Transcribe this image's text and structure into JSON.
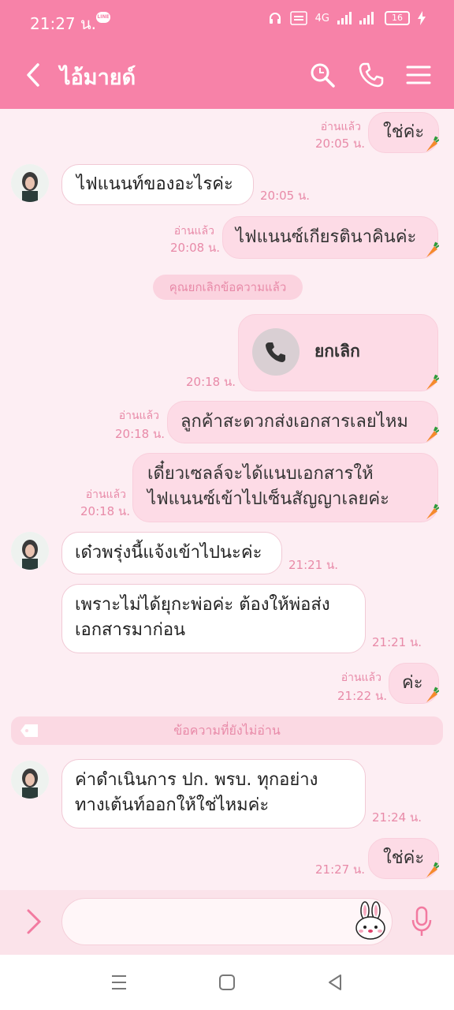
{
  "status": {
    "time": "21:27 น.",
    "line_badge": "LINE",
    "battery": "16",
    "network": "4G"
  },
  "header": {
    "title": "ไอ้มายด์"
  },
  "messages": [
    {
      "dir": "out",
      "text": "ใช่ค่ะ",
      "read": "อ่านแล้ว",
      "time": "20:05 น."
    },
    {
      "dir": "in",
      "text": "ไฟแนนท์ของอะไรค่ะ",
      "time": "20:05 น."
    },
    {
      "dir": "out",
      "text": "ไฟแนนซ์เกียรตินาคินค่ะ",
      "read": "อ่านแล้ว",
      "time": "20:08 น."
    },
    {
      "dir": "system",
      "text": "คุณยกเลิกข้อความแล้ว"
    },
    {
      "dir": "out",
      "type": "call",
      "text": "ยกเลิก",
      "time": "20:18 น."
    },
    {
      "dir": "out",
      "text": "ลูกค้าสะดวกส่งเอกสารเลยไหม",
      "read": "อ่านแล้ว",
      "time": "20:18 น."
    },
    {
      "dir": "out",
      "text_line1": "เดี๋ยวเซลล์จะได้แนบเอกสารให้",
      "text_line2": "ไฟแนนซ์เข้าไปเซ็นสัญญาเลยค่ะ",
      "read": "อ่านแล้ว",
      "time": "20:18 น."
    },
    {
      "dir": "in",
      "text": "เด๋วพรุ่งนี้แจ้งเข้าไปนะค่ะ",
      "time": "21:21 น."
    },
    {
      "dir": "in",
      "text_line1": "เพราะไม่ได้ยุกะพ่อค่ะ ต้องให้พ่อส่ง",
      "text_line2": "เอกสารมาก่อน",
      "time": "21:21 น."
    },
    {
      "dir": "out",
      "text": "ค่ะ",
      "read": "อ่านแล้ว",
      "time": "21:22 น."
    },
    {
      "dir": "unread",
      "text": "ข้อความที่ยังไม่อ่าน"
    },
    {
      "dir": "in",
      "text_line1": "ค่าดำเนินการ ปก. พรบ. ทุกอย่าง",
      "text_line2": "ทางเต้นท์ออกให้ใช่ไหมค่ะ",
      "time": "21:24 น."
    },
    {
      "dir": "out",
      "text": "ใช่ค่ะ",
      "time": "21:27 น."
    }
  ],
  "colors": {
    "accent": "#f782a8",
    "bubble_out": "#fddbe6",
    "meta_text": "#e88aa8"
  },
  "icons": [
    "back-icon",
    "search-icon",
    "phone-icon",
    "menu-icon",
    "carrot-sticker-icon",
    "expand-arrow-icon",
    "brown-bunny-sticker-icon",
    "mic-icon"
  ]
}
